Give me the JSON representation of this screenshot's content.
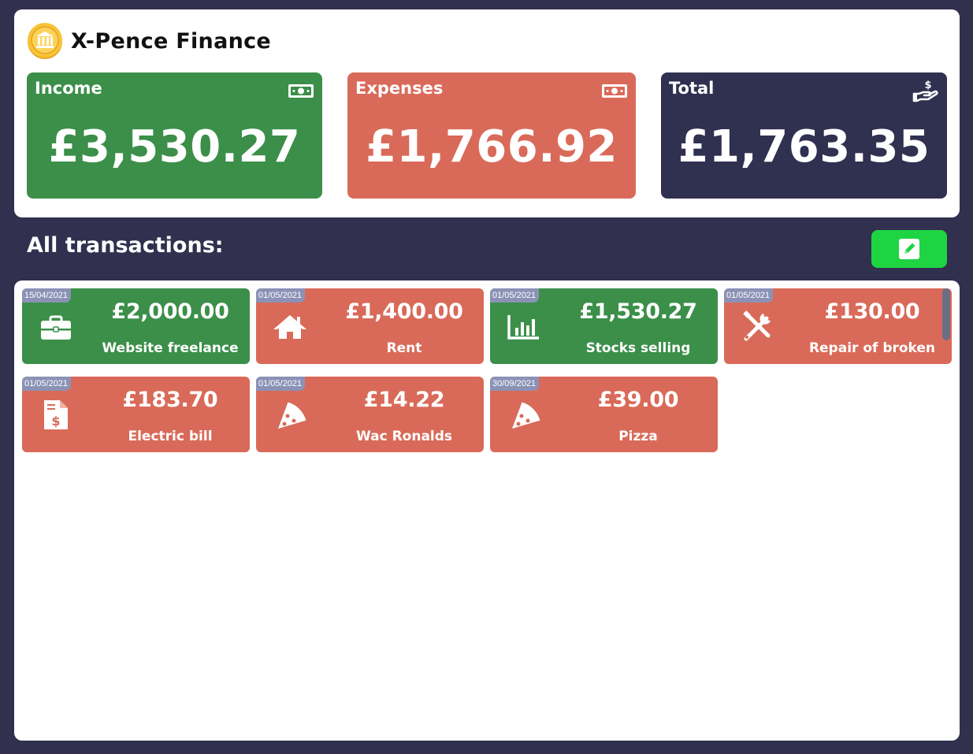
{
  "app": {
    "title": "X-Pence Finance",
    "logo_icon": "coin-bank-icon"
  },
  "summary": {
    "income": {
      "label": "Income",
      "value": "£3,530.27",
      "icon": "banknote-icon",
      "color": "#3b8f49"
    },
    "expenses": {
      "label": "Expenses",
      "value": "£1,766.92",
      "icon": "banknote-icon",
      "color": "#d96a59"
    },
    "total": {
      "label": "Total",
      "value": "£1,763.35",
      "icon": "hand-holding-dollar-icon",
      "color": "#303050"
    }
  },
  "transactions_section": {
    "title": "All transactions:",
    "edit_icon": "pencil-square-icon",
    "edit_button_color": "#1ed443"
  },
  "transactions": [
    {
      "date": "15/04/2021",
      "amount": "£2,000.00",
      "description": "Website freelance",
      "type": "income",
      "icon": "briefcase-icon"
    },
    {
      "date": "01/05/2021",
      "amount": "£1,400.00",
      "description": "Rent",
      "type": "expense",
      "icon": "house-icon"
    },
    {
      "date": "01/05/2021",
      "amount": "£1,530.27",
      "description": "Stocks selling",
      "type": "income",
      "icon": "bar-chart-icon"
    },
    {
      "date": "01/05/2021",
      "amount": "£130.00",
      "description": "Repair of broken",
      "type": "expense",
      "icon": "tools-icon"
    },
    {
      "date": "01/05/2021",
      "amount": "£183.70",
      "description": "Electric bill",
      "type": "expense",
      "icon": "invoice-dollar-icon"
    },
    {
      "date": "01/05/2021",
      "amount": "£14.22",
      "description": "Wac Ronalds",
      "type": "expense",
      "icon": "pizza-slice-icon"
    },
    {
      "date": "30/09/2021",
      "amount": "£39.00",
      "description": "Pizza",
      "type": "expense",
      "icon": "pizza-slice-icon"
    }
  ]
}
